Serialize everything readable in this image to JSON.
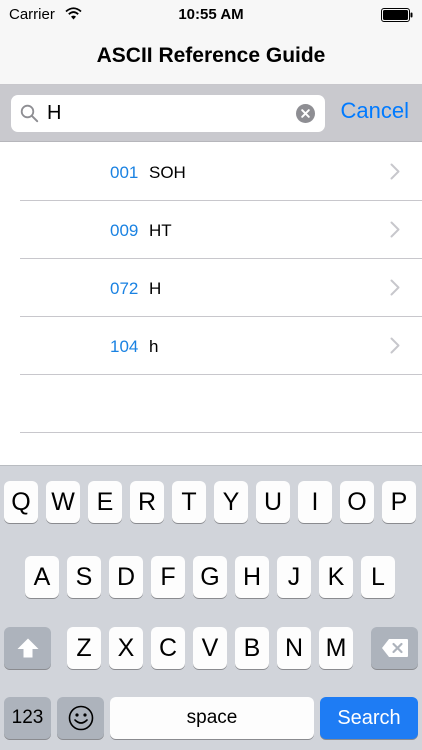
{
  "status_bar": {
    "carrier": "Carrier",
    "time": "10:55 AM"
  },
  "nav": {
    "title": "ASCII Reference Guide"
  },
  "search": {
    "value": "H",
    "cancel_label": "Cancel"
  },
  "results": [
    {
      "code": "001",
      "name": "SOH"
    },
    {
      "code": "009",
      "name": "HT"
    },
    {
      "code": "072",
      "name": "H"
    },
    {
      "code": "104",
      "name": "h"
    }
  ],
  "keyboard": {
    "row1": [
      "Q",
      "W",
      "E",
      "R",
      "T",
      "Y",
      "U",
      "I",
      "O",
      "P"
    ],
    "row2": [
      "A",
      "S",
      "D",
      "F",
      "G",
      "H",
      "J",
      "K",
      "L"
    ],
    "row3": [
      "Z",
      "X",
      "C",
      "V",
      "B",
      "N",
      "M"
    ],
    "numbers_label": "123",
    "space_label": "space",
    "search_label": "Search"
  },
  "colors": {
    "accent": "#007aff",
    "code": "#1a82e2",
    "search_key": "#1e7cf4"
  }
}
